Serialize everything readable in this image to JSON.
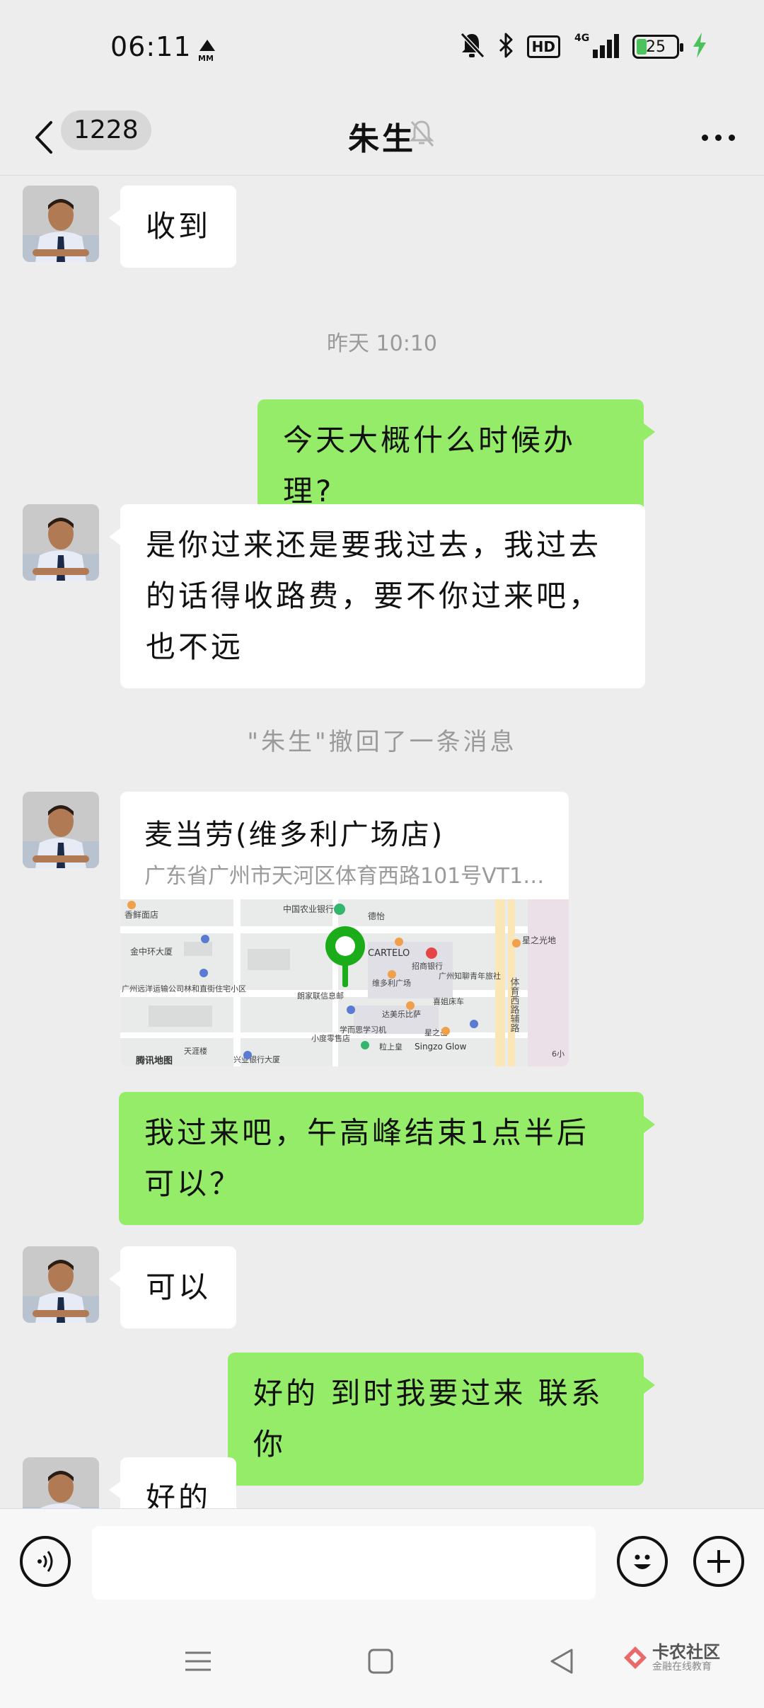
{
  "status_bar": {
    "time": "06:11",
    "small_text": "MM",
    "hd": "HD",
    "network": "4G",
    "battery": "25",
    "battery_level": 0.25
  },
  "header": {
    "unread_count": "1228",
    "title": "朱生"
  },
  "messages": {
    "m1": "收到",
    "ts1": "昨天 10:10",
    "m2": "今天大概什么时候办理?",
    "m3": "是你过来还是要我过去，我过去的话得收路费，要不你过来吧，也不远",
    "recall": "\"朱生\"撤回了一条消息",
    "location_name": "麦当劳(维多利广场店)",
    "location_address": "广东省广州市天河区体育西路101号VT10…",
    "m4": "我过来吧，午高峰结束1点半后可以？",
    "m5": "可以",
    "m6": "好的 到时我要过来 联系你",
    "m7": "好的"
  },
  "map_labels": {
    "l1": "中国农业银行",
    "l2": "德怡",
    "l3": "香鲜面店",
    "l4": "金中环大厦",
    "l5": "CARTELO",
    "l6": "招商银行",
    "l7": "星之光地",
    "l8": "广州知聊青年旅社",
    "l9": "维多利广场",
    "l10": "广州远洋运输公司林和直街住宅小区",
    "l11": "朗家联信息邮",
    "l12": "喜姐床车",
    "l13": "达美乐比萨",
    "l14": "学而思学习机",
    "l15": "星之岳",
    "l16": "粒上皇",
    "l17": "Singzo Glow",
    "l18": "小度零售店",
    "l19": "腾讯地图",
    "l20": "兴业银行大厦",
    "l21": "天涯楼",
    "l22": "体育西路辅路",
    "l23": "6小"
  },
  "input": {
    "placeholder": ""
  },
  "watermark": {
    "title": "卡农社区",
    "subtitle": "金融在线教育"
  },
  "colors": {
    "bg": "#ededed",
    "my_bubble": "#95ec69",
    "their_bubble": "#ffffff",
    "pin": "#1aad19"
  }
}
